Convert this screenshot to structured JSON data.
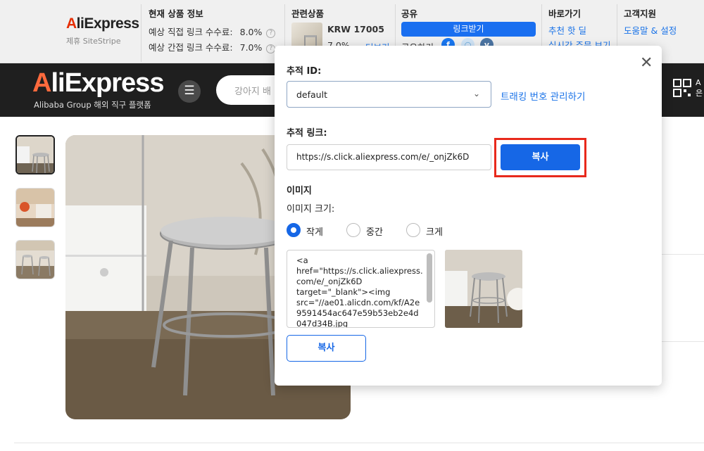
{
  "stripe": {
    "logo_text": "AliExpress",
    "logo_sub": "제휴 SiteStripe",
    "current_info": {
      "title": "현재 상품 정보",
      "direct_label": "예상 직접 링크 수수료:",
      "direct_value": "8.0%",
      "indirect_label": "예상 간접 링크 수수료:",
      "indirect_value": "7.0%"
    },
    "related": {
      "title": "관련상품",
      "price": "KRW 17005",
      "commission": "7.0%",
      "more": "더보기"
    },
    "share": {
      "title": "공유",
      "get_link": "링크받기",
      "share_label": "공유하기"
    },
    "shortcuts": {
      "title": "바로가기",
      "item1": "추천 핫 딜",
      "item2": "실시간 주문 보기"
    },
    "support": {
      "title": "고객지원",
      "item1": "도움말 & 설정"
    }
  },
  "header": {
    "logo": "AliExpress",
    "logo_sub": "Alibaba Group 해외 직구 플랫폼",
    "search_placeholder": "강아지 배",
    "right_text_1": "A",
    "right_text_2": "은"
  },
  "modal": {
    "tracking_id_label": "추적 ID:",
    "tracking_id_value": "default",
    "manage_link": "트래킹 번호 관리하기",
    "tracking_link_label": "추적 링크:",
    "tracking_link_value": "https://s.click.aliexpress.com/e/_onjZk6D",
    "copy_label": "복사",
    "image_section": "이미지",
    "image_size_label": "이미지 크기:",
    "sizes": [
      "작게",
      "중간",
      "크게"
    ],
    "selected_size": "작게",
    "code_snippet": "<a\nhref=\"https://s.click.aliexpress.com/e/_onjZk6D\ntarget=\"_blank\"><img\nsrc=\"//ae01.alicdn.com/kf/A2e9591454ac647e59b53eb2e4d047d34B.jpg",
    "copy_label_2": "복사"
  },
  "colors": {
    "accent_blue": "#1667e6",
    "highlight_red": "#e8291c",
    "header_dark": "#1f1f1f",
    "stripe_bg": "#f0f0f0"
  }
}
